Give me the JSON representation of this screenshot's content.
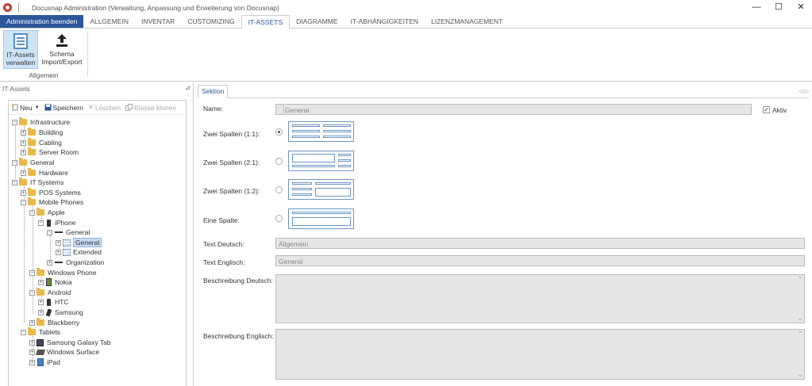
{
  "window": {
    "title": "Docusnap Administration (Verwaltung, Anpassung und Erweiterung von Docusnap)",
    "minimize": "—",
    "maximize": "☐",
    "close": "✕"
  },
  "menu": {
    "admin_button": "Administration beenden",
    "tabs": [
      "ALLGEMEIN",
      "INVENTAR",
      "CUSTOMIZING",
      "IT-ASSETS",
      "DIAGRAMME",
      "IT-ABHÄNGIGKEITEN",
      "LIZENZMANAGEMENT"
    ],
    "active_tab": "IT-ASSETS"
  },
  "ribbon": {
    "btn1_line1": "IT-Assets",
    "btn1_line2": "verwalten",
    "btn2_line1": "Schema",
    "btn2_line2": "Import/Export",
    "group": "Allgemein"
  },
  "left": {
    "title": "IT Assets",
    "pin": "⊿",
    "toolbar": {
      "new": "Neu",
      "save": "Speichern",
      "delete": "Löschen",
      "clone": "Klasse klonen"
    },
    "tree": [
      "Infrastructure",
      "Building",
      "Cabling",
      "Server Room",
      "General",
      "Hardware",
      "IT Systems",
      "POS Systems",
      "Mobile Phones",
      "Apple",
      "iPhone",
      "General",
      "General",
      "Extended",
      "Organization",
      "Windows Phone",
      "Nokia",
      "Android",
      "HTC",
      "Samsung",
      "Blackberry",
      "Tablets",
      "Samsung Galaxy Tab",
      "Windows Surface",
      "iPad"
    ]
  },
  "right": {
    "tab": "Sektion",
    "arrows": "◁ ▷",
    "name_label": "Name:",
    "name_value": "General",
    "active_label": "Aktiv",
    "layout1": "Zwei Spalten (1:1):",
    "layout2": "Zwei Spalten (2:1):",
    "layout3": "Zwei Spalten (1:2):",
    "layout4": "Eine Spalte:",
    "text_de_label": "Text Deutsch:",
    "text_de_value": "Allgemein",
    "text_en_label": "Text Englisch:",
    "text_en_value": "General",
    "desc_de_label": "Beschreibung Deutsch:",
    "desc_en_label": "Beschreibung Englisch:"
  }
}
